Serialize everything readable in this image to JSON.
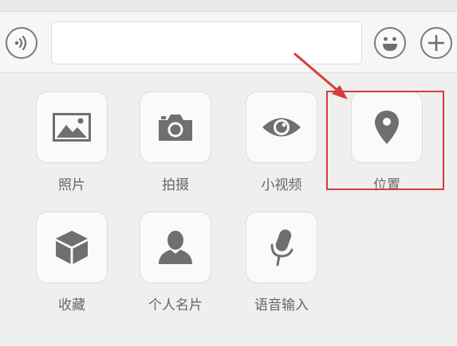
{
  "input_bar": {
    "voice_icon": "voice-icon",
    "text_value": "",
    "emoji_icon": "emoji-icon",
    "plus_icon": "plus-icon"
  },
  "panel": {
    "items": [
      {
        "label": "照片",
        "icon": "photo-icon"
      },
      {
        "label": "拍摄",
        "icon": "camera-icon"
      },
      {
        "label": "小视频",
        "icon": "eye-icon"
      },
      {
        "label": "位置",
        "icon": "location-pin-icon"
      },
      {
        "label": "收藏",
        "icon": "cube-icon"
      },
      {
        "label": "个人名片",
        "icon": "person-icon"
      },
      {
        "label": "语音输入",
        "icon": "microphone-icon"
      }
    ]
  },
  "annotation": {
    "highlight_color": "#d83b3b",
    "highlighted_item": "位置"
  },
  "colors": {
    "icon": "#6f6f6f",
    "label": "#666666",
    "background": "#efefef"
  }
}
